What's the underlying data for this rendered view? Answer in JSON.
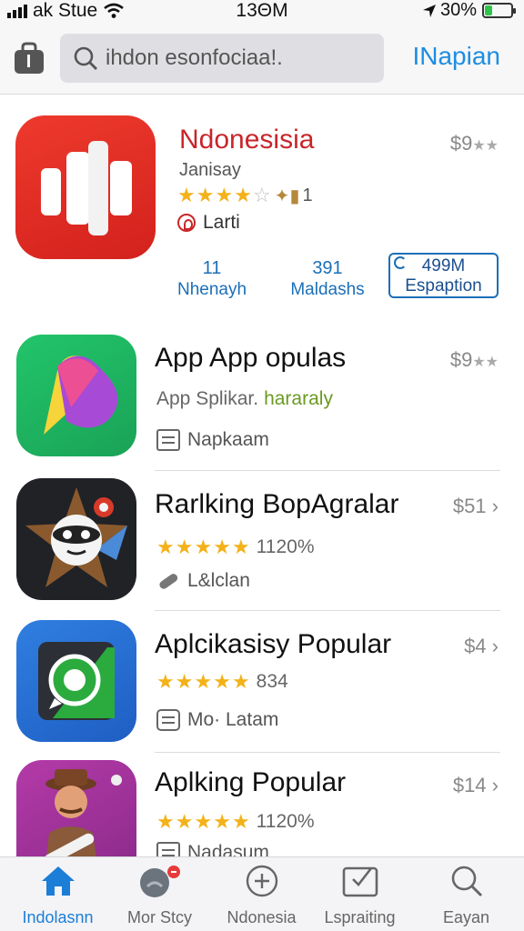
{
  "status_bar": {
    "carrier": "ak Stue",
    "time": "13ΘM",
    "battery": "30%",
    "battery_level": 0.3
  },
  "header": {
    "search_placeholder": "ihdon esonfociaa!.",
    "right_link": "INapian"
  },
  "featured": {
    "title": "Ndonesisia",
    "price": "$9",
    "subtitle": "Janisay",
    "rating": 4,
    "rating_suffix": "1",
    "tag": "Larti",
    "stats": [
      {
        "value": "11",
        "label": "Nhenayh"
      },
      {
        "value": "391",
        "label": "Maldashs"
      }
    ],
    "expand_button": {
      "value": "499M",
      "label": "Espaption"
    }
  },
  "apps": [
    {
      "title": "App App opulas",
      "price": "$9",
      "price_style": "stars",
      "subtitle": "App Splikar.",
      "subtitle_tag": "hararaly",
      "meta": "Napkaam",
      "meta_icon": "list-box-icon",
      "rating": null,
      "rating_text": ""
    },
    {
      "title": "Rarlking BopAgralar",
      "price": "$51",
      "price_style": "chevron",
      "subtitle": "",
      "subtitle_tag": "",
      "meta": "L&lclan",
      "meta_icon": "pill-icon",
      "rating": 5,
      "rating_text": "1120%"
    },
    {
      "title": "Aplcikasisy Popular",
      "price": "$4",
      "price_style": "chevron",
      "subtitle": "",
      "subtitle_tag": "",
      "meta": "Mo· Latam",
      "meta_icon": "camera-box-icon",
      "rating": 5,
      "rating_text": "834"
    },
    {
      "title": "Aplking Popular",
      "price": "$14",
      "price_style": "chevron",
      "subtitle": "",
      "subtitle_tag": "",
      "meta": "Nadasum",
      "meta_icon": "list-box-icon",
      "rating": 5,
      "rating_text": "1120%"
    }
  ],
  "tabs": [
    {
      "label": "Indolasnn",
      "icon": "home-icon",
      "active": true
    },
    {
      "label": "Mor Stcy",
      "icon": "avatar-icon",
      "active": false
    },
    {
      "label": "Ndonesia",
      "icon": "plus-circle-icon",
      "active": false
    },
    {
      "label": "Lspraiting",
      "icon": "edit-box-icon",
      "active": false
    },
    {
      "label": "Eayan",
      "icon": "search-icon",
      "active": false
    }
  ],
  "colors": {
    "accent": "#1c8de3",
    "featured_title": "#c8262a",
    "star": "#f3b21a"
  }
}
